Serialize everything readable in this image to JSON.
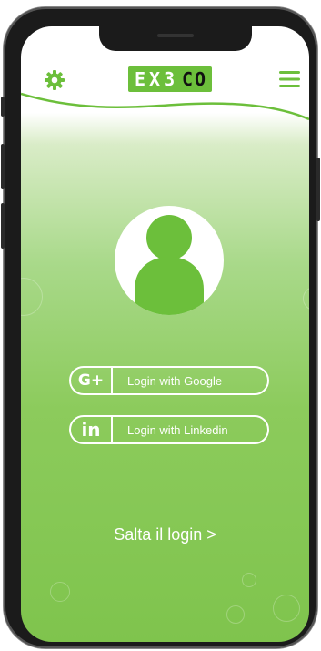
{
  "header": {
    "settings_icon": "gear-icon",
    "menu_icon": "hamburger-menu-icon",
    "logo": {
      "left_text": "EX3",
      "right_text": "CO"
    }
  },
  "colors": {
    "brand_green": "#6cbf3b",
    "gradient_bottom": "#7fc44d",
    "text_on_green": "#ffffff"
  },
  "avatar": {
    "icon": "user-avatar-icon"
  },
  "login_buttons": [
    {
      "icon": "google-plus-icon",
      "icon_text": "G+",
      "label": "Login with Google"
    },
    {
      "icon": "linkedin-icon",
      "icon_text": "in",
      "label": "Login with Linkedin"
    }
  ],
  "skip_login": "Salta il login >"
}
